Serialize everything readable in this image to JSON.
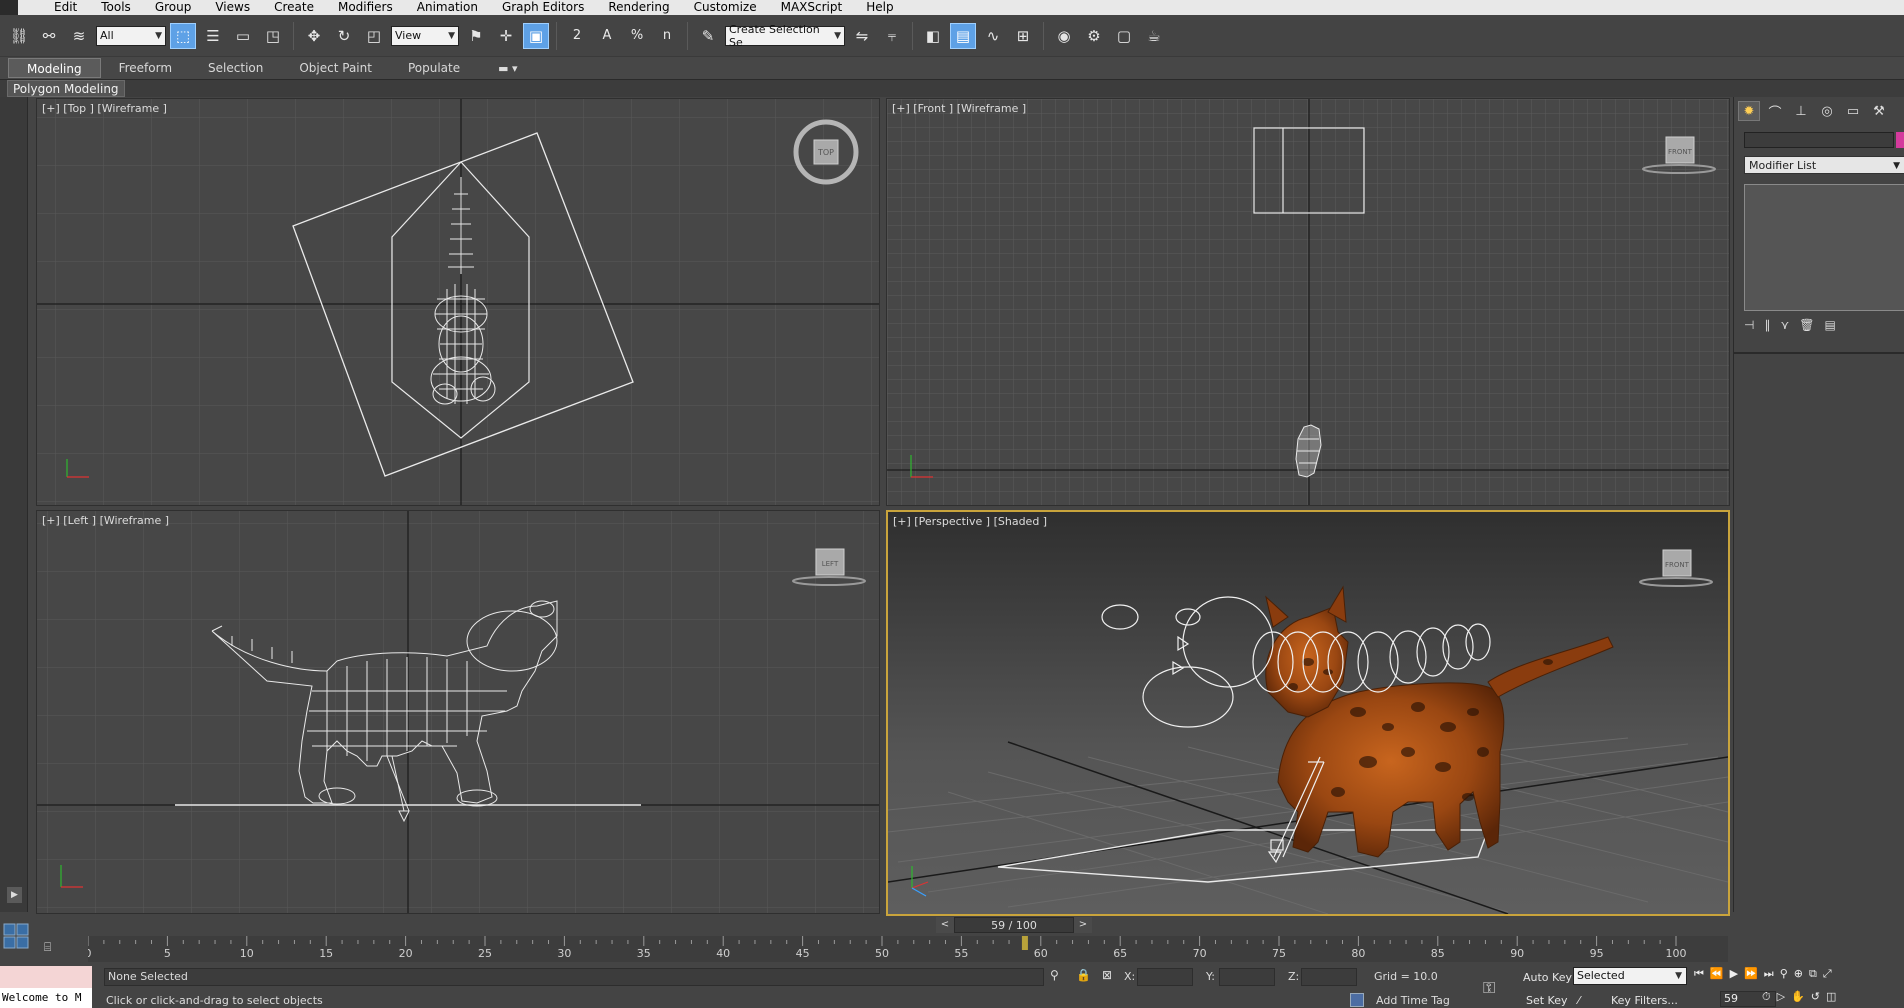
{
  "menu": {
    "items": [
      "Edit",
      "Tools",
      "Group",
      "Views",
      "Create",
      "Modifiers",
      "Animation",
      "Graph Editors",
      "Rendering",
      "Customize",
      "MAXScript",
      "Help"
    ]
  },
  "toolbar": {
    "filter_value": "All",
    "ref_coord_value": "View",
    "named_selection_value": "Create Selection Se",
    "snap_label": "2",
    "angle_snap_label": "A",
    "percent_snap_label": "%",
    "spinner_snap_label": "n"
  },
  "ribbon": {
    "tabs": [
      "Modeling",
      "Freeform",
      "Selection",
      "Object Paint",
      "Populate"
    ],
    "sub_label": "Polygon Modeling"
  },
  "viewports": {
    "top": {
      "label": "[+] [Top ] [Wireframe ]",
      "cube": "TOP"
    },
    "front": {
      "label": "[+] [Front ] [Wireframe ]",
      "cube": "FRONT"
    },
    "left": {
      "label": "[+] [Left ] [Wireframe ]",
      "cube": "LEFT"
    },
    "perspective": {
      "label": "[+] [Perspective ] [Shaded ]",
      "cube": "FRONT"
    }
  },
  "command_panel": {
    "modifier_list": "Modifier List"
  },
  "timeline": {
    "current_frame": 59,
    "total_frames": 100,
    "slider_text": "59 / 100",
    "prev": "<",
    "next": ">",
    "ticks": [
      "0",
      "5",
      "10",
      "15",
      "20",
      "25",
      "30",
      "35",
      "40",
      "45",
      "50",
      "55",
      "60",
      "65",
      "70",
      "75",
      "80",
      "85",
      "90",
      "95",
      "100"
    ]
  },
  "status": {
    "listener_text": "Welcome to M",
    "selection_text": "None Selected",
    "prompt_text": "Click or click-and-drag to select objects",
    "x_label": "X:",
    "y_label": "Y:",
    "z_label": "Z:",
    "grid_text": "Grid = 10.0",
    "add_time_tag": "Add Time Tag",
    "auto_key": "Auto Key",
    "set_key": "Set Key",
    "selected_value": "Selected",
    "key_filters": "Key Filters...",
    "frame_value": "59"
  }
}
